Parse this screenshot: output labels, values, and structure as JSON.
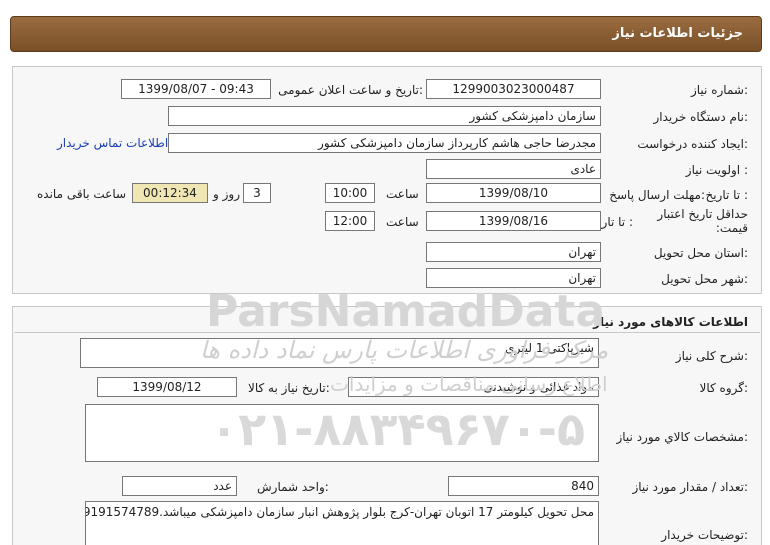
{
  "header": {
    "title": "جزئیات اطلاعات نیاز"
  },
  "need_info": {
    "need_number_label": "شماره نیاز:",
    "need_number": "1299003023000487",
    "announce_label": "تاریخ و ساعت اعلان عمومی:",
    "announce_value": "1399/08/07 - 09:43",
    "buyer_org_label": "نام دستگاه خریدار:",
    "buyer_org": "سازمان دامپزشکی کشور",
    "creator_label": "ایجاد کننده درخواست:",
    "creator": "مجدرضا حاجی هاشم کارپرداز سازمان دامپزشکی کشور",
    "contact_link": "اطلاعات تماس خریدار",
    "priority_label": "اولویت نیاز :",
    "priority": "عادی",
    "deadline_label": "مهلت ارسال پاسخ:",
    "to_date_label": "تا تاریخ :",
    "deadline_date": "1399/08/10",
    "time_label": "ساعت",
    "deadline_time": "10:00",
    "days_value": "3",
    "days_label": "روز و",
    "remaining_time": "00:12:34",
    "remaining_label": "ساعت باقی مانده",
    "price_validity_label": "حداقل تاریخ اعتبار قیمت:",
    "price_to_date_label": "تا تاریخ :",
    "price_date": "1399/08/16",
    "price_time_label": "ساعت",
    "price_time": "12:00",
    "province_label": "استان محل تحویل:",
    "province": "تهران",
    "city_label": "شهر محل تحویل:",
    "city": "تهران"
  },
  "goods_info": {
    "section_title": "اطلاعات کالاهای مورد نیاز",
    "summary_label": "شرح کلی نیاز:",
    "summary": "شیرپاکتی 1 لیتری",
    "group_label": "گروه کالا:",
    "group": "مواد غذائی و نوشیدنی",
    "need_date_label": "تاریخ نیاز به کالا:",
    "need_date": "1399/08/12",
    "specs_label": "مشخصات کالاي مورد نیاز:",
    "specs": "",
    "qty_label": "تعداد / مقدار مورد نیاز:",
    "qty": "840",
    "unit_label": "واحد شمارش:",
    "unit": "عدد",
    "notes_label": "توضیحات خریدار:",
    "notes": "محل تحویل کیلومتر 17 اتوبان تهران-کرج بلوار پژوهش انبار سازمان دامپزشکی میباشد.09191574789"
  },
  "watermark": {
    "brand": "ParsNamadData",
    "line1": "مرکز فراوری اطلاعات پارس نماد داده ها",
    "line2": "اطلاع رسانی مناقصات و مزایدات",
    "phone": "۰۲۱-۸۸۳۴۹۶۷۰-۵"
  }
}
